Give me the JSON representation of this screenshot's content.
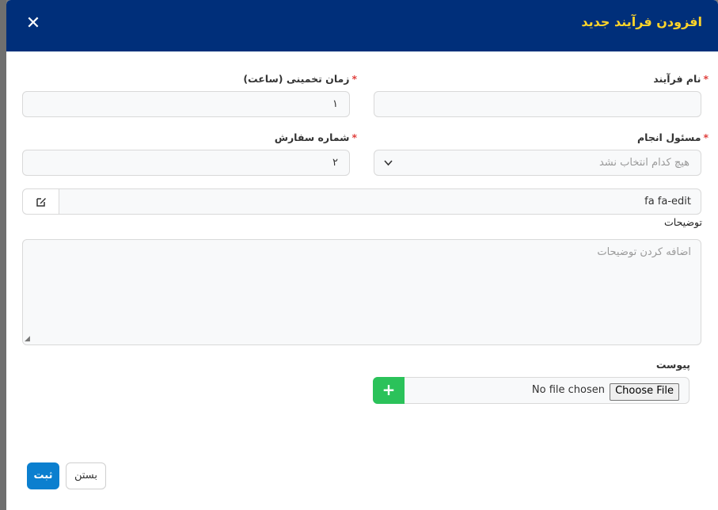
{
  "modal": {
    "title": "افزودن فرآیند جدید",
    "close_icon": "close-icon"
  },
  "form": {
    "process_name": {
      "label": "نام فرآیند",
      "required": "*",
      "value": ""
    },
    "estimated_time": {
      "label": "زمان تخمینی (ساعت)",
      "required": "*",
      "value": "۱"
    },
    "responsible": {
      "label": "مسئول انجام",
      "required": "*",
      "placeholder": "هیچ کدام انتخاب نشد",
      "arrow_icon": "chevron-down-icon"
    },
    "order_number": {
      "label": "شماره سفارش",
      "required": "*",
      "value": "۲"
    },
    "icon": {
      "value": "fa fa-edit",
      "addon_icon": "edit-icon"
    },
    "description": {
      "label": "توضیحات",
      "placeholder": "اضافه کردن توضیحات"
    },
    "attachment": {
      "label": "پیوست",
      "add_label": "+",
      "choose_label": "Choose File",
      "status": "No file chosen"
    }
  },
  "footer": {
    "submit_label": "ثبت",
    "close_label": "بستن"
  },
  "colors": {
    "header_bg": "#002f7a",
    "title": "#ffd42a",
    "primary": "#0b7fcf",
    "success": "#2bc25a",
    "required": "#e0413e"
  }
}
